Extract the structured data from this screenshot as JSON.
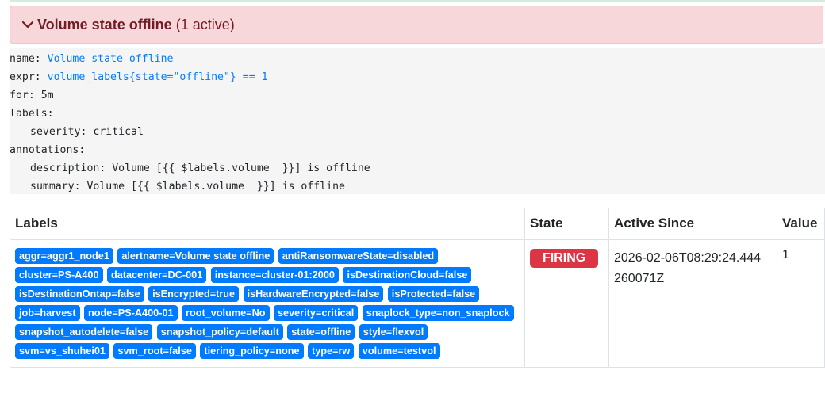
{
  "alert": {
    "title": "Volume state offline",
    "count": "(1 active)"
  },
  "rule": {
    "name_key": "name:",
    "name_value": "Volume state offline",
    "expr_key": "expr:",
    "expr_value": "volume_labels{state=\"offline\"} == 1",
    "for_line": "for: 5m",
    "labels_key": "labels:",
    "severity_line": "severity: critical",
    "annotations_key": "annotations:",
    "description_line": "description: Volume [{{ $labels.volume  }}] is offline",
    "summary_line": "summary: Volume [{{ $labels.volume  }}] is offline"
  },
  "table": {
    "headers": [
      "Labels",
      "State",
      "Active Since",
      "Value"
    ],
    "row": {
      "labels": [
        "aggr=aggr1_node1",
        "alertname=Volume state offline",
        "antiRansomwareState=disabled",
        "cluster=PS-A400",
        "datacenter=DC-001",
        "instance=cluster-01:2000",
        "isDestinationCloud=false",
        "isDestinationOntap=false",
        "isEncrypted=true",
        "isHardwareEncrypted=false",
        "isProtected=false",
        "job=harvest",
        "node=PS-A400-01",
        "root_volume=No",
        "severity=critical",
        "snaplock_type=non_snaplock",
        "snapshot_autodelete=false",
        "snapshot_policy=default",
        "state=offline",
        "style=flexvol",
        "svm=vs_shuhei01",
        "svm_root=false",
        "tiering_policy=none",
        "type=rw",
        "volume=testvol"
      ],
      "state": "FIRING",
      "active_since": "2026-02-06T08:29:24.444260071Z",
      "value": "1"
    }
  },
  "colors": {
    "alert_bg": "#f8d7da",
    "alert_text": "#721c24",
    "badge": "#007bff",
    "firing": "#dc3545",
    "code_bg": "#f5f5f5"
  }
}
